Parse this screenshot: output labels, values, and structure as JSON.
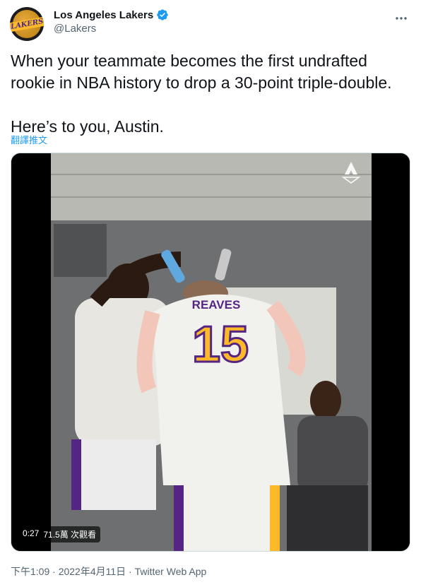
{
  "author": {
    "display_name": "Los Angeles Lakers",
    "handle": "@Lakers",
    "avatar_text": "LAKERS"
  },
  "tweet": {
    "text": "When your teammate becomes the first undrafted rookie in NBA history to drop a 30-point triple-double.\n\nHere’s to you, Austin.",
    "translate_label": "翻譯推文"
  },
  "video": {
    "duration": "0:27",
    "views": "71.5萬 次觀看",
    "jersey_name": "REAVES",
    "jersey_number": "15"
  },
  "meta": {
    "timestamp": "下午1:09 · 2022年4月11日",
    "separator": " · ",
    "source": "Twitter Web App"
  },
  "colors": {
    "accent": "#1d9bf0",
    "lakers_purple": "#552583",
    "lakers_gold": "#fdb927"
  }
}
